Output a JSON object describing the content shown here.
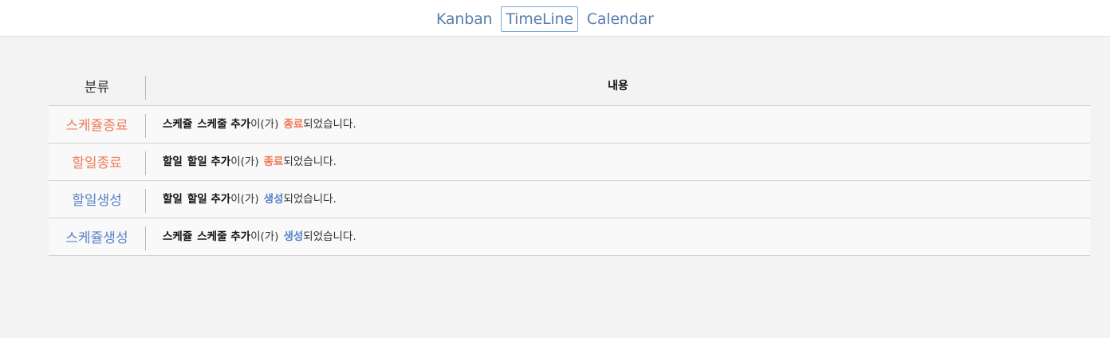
{
  "nav": {
    "tabs": [
      {
        "label": "Kanban",
        "active": false
      },
      {
        "label": "TimeLine",
        "active": true
      },
      {
        "label": "Calendar",
        "active": false
      }
    ]
  },
  "table": {
    "headers": {
      "category": "분류",
      "content": "내용"
    },
    "rows": [
      {
        "category": "스케쥴종료",
        "category_color": "#f07b57",
        "type_word": "스케쥴",
        "title": "스케줄 추가",
        "particle": "이(가)",
        "status": "종료",
        "status_color": "#f07b57",
        "suffix": "되었습니다."
      },
      {
        "category": "할일종료",
        "category_color": "#f07b57",
        "type_word": "할일",
        "title": "할일 추가",
        "particle": "이(가)",
        "status": "종료",
        "status_color": "#f07b57",
        "suffix": "되었습니다."
      },
      {
        "category": "할일생성",
        "category_color": "#5a82c8",
        "type_word": "할일",
        "title": "할일 추가",
        "particle": "이(가)",
        "status": "생성",
        "status_color": "#5a82c8",
        "suffix": "되었습니다."
      },
      {
        "category": "스케쥴생성",
        "category_color": "#5a82c8",
        "type_word": "스케쥴",
        "title": "스케줄 추가",
        "particle": "이(가)",
        "status": "생성",
        "status_color": "#5a82c8",
        "suffix": "되었습니다."
      }
    ]
  },
  "colors": {
    "nav_text": "#5a7fae",
    "active_border": "#7ba7dc",
    "page_bg": "#f3f3f3"
  }
}
